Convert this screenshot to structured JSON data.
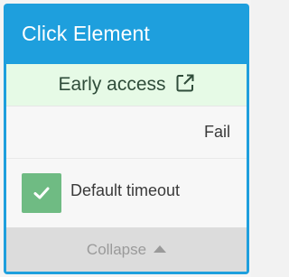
{
  "node": {
    "title": "Click Element",
    "early_access": {
      "label": "Early access",
      "icon": "external-link-icon"
    },
    "output": {
      "fail_label": "Fail"
    },
    "options": [
      {
        "label": "Default timeout",
        "checked": true
      }
    ],
    "collapse_label": "Collapse"
  },
  "colors": {
    "header": "#1e9fdd",
    "early_access_bg": "#e6fae6",
    "checkbox": "#6fbb83",
    "collapse_bg": "#dcdcdc"
  }
}
